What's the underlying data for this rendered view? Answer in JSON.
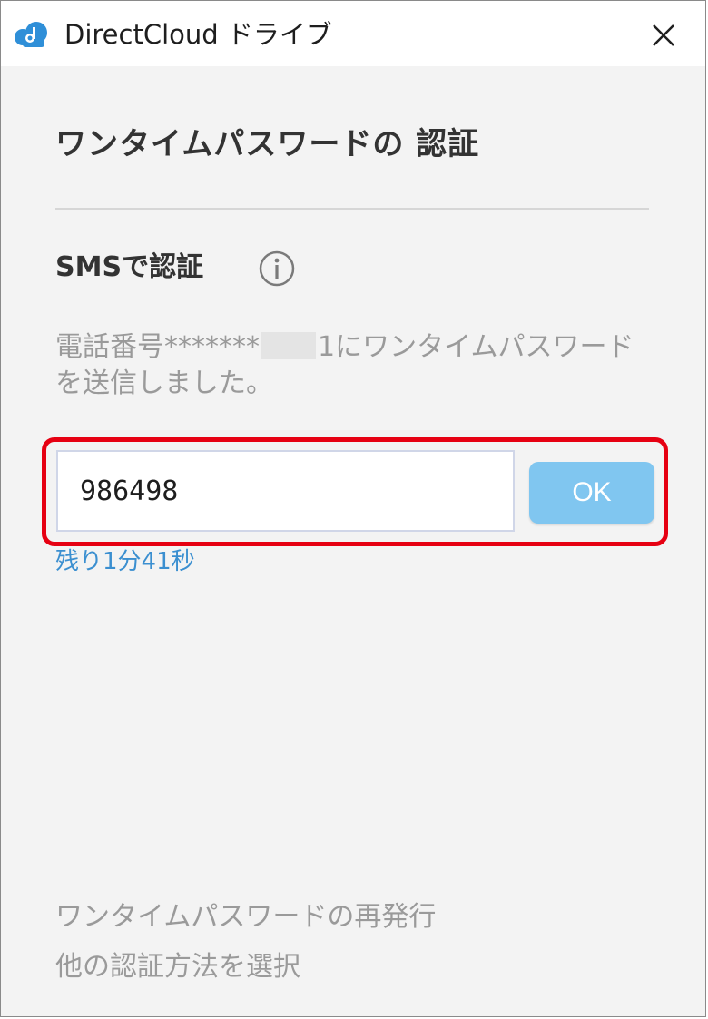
{
  "window": {
    "title": "DirectCloud ドライブ",
    "close_icon": "close-icon",
    "logo_icon": "cloud-logo-icon",
    "brand_color": "#2f8fd8"
  },
  "dialog": {
    "heading": "ワンタイムパスワードの 認証",
    "method_label": "SMSで認証",
    "info_icon": "info-icon",
    "description_prefix": "電話番号*******",
    "description_suffix": "1にワンタイムパスワードを送信しました。",
    "otp_value": "986498",
    "ok_label": "OK",
    "ok_color": "#80c6f0",
    "highlight_color": "#e60012",
    "timer": "残り1分41秒",
    "resend_link": "ワンタイムパスワードの再発行",
    "other_method_link": "他の認証方法を選択"
  }
}
